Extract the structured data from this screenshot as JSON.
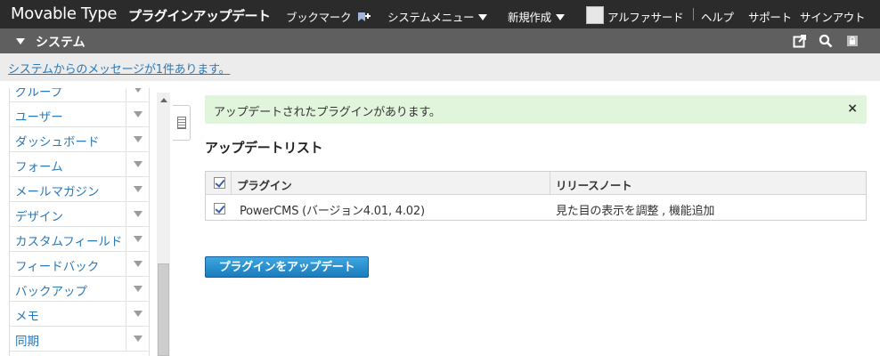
{
  "header": {
    "brand": "Movable Type",
    "page_title": "プラグインアップデート",
    "nav": {
      "bookmark": "ブックマーク",
      "system_menu": "システムメニュー",
      "new_create": "新規作成",
      "user": "アルファサード",
      "help": "ヘルプ",
      "support": "サポート",
      "signout": "サインアウト"
    }
  },
  "system_bar": {
    "label": "システム",
    "icons": [
      "external-link-icon",
      "search-icon",
      "lock-icon"
    ]
  },
  "message_bar": {
    "link": "システムからのメッセージが1件あります。"
  },
  "sidebar": {
    "items": [
      {
        "label": "グループ"
      },
      {
        "label": "ユーザー"
      },
      {
        "label": "ダッシュボード"
      },
      {
        "label": "フォーム"
      },
      {
        "label": "メールマガジン"
      },
      {
        "label": "デザイン"
      },
      {
        "label": "カスタムフィールド"
      },
      {
        "label": "フィードバック"
      },
      {
        "label": "バックアップ"
      },
      {
        "label": "メモ"
      },
      {
        "label": "同期"
      }
    ]
  },
  "alert": {
    "message": "アップデートされたプラグインがあります。",
    "close": "×"
  },
  "update_list": {
    "heading": "アップデートリスト",
    "columns": [
      "プラグイン",
      "リリースノート"
    ],
    "rows": [
      {
        "plugin": "PowerCMS (バージョン4.01, 4.02)",
        "notes": "見た目の表示を調整 , 機能追加",
        "checked": true
      }
    ],
    "header_checked": true
  },
  "actions": {
    "update_button": "プラグインをアップデート"
  },
  "colors": {
    "topbar": "#2b2b2b",
    "system_bar": "#5f5f5f",
    "link": "#2b79b8",
    "alert_bg": "#e1f5dc",
    "button": "#1a7cbd"
  }
}
